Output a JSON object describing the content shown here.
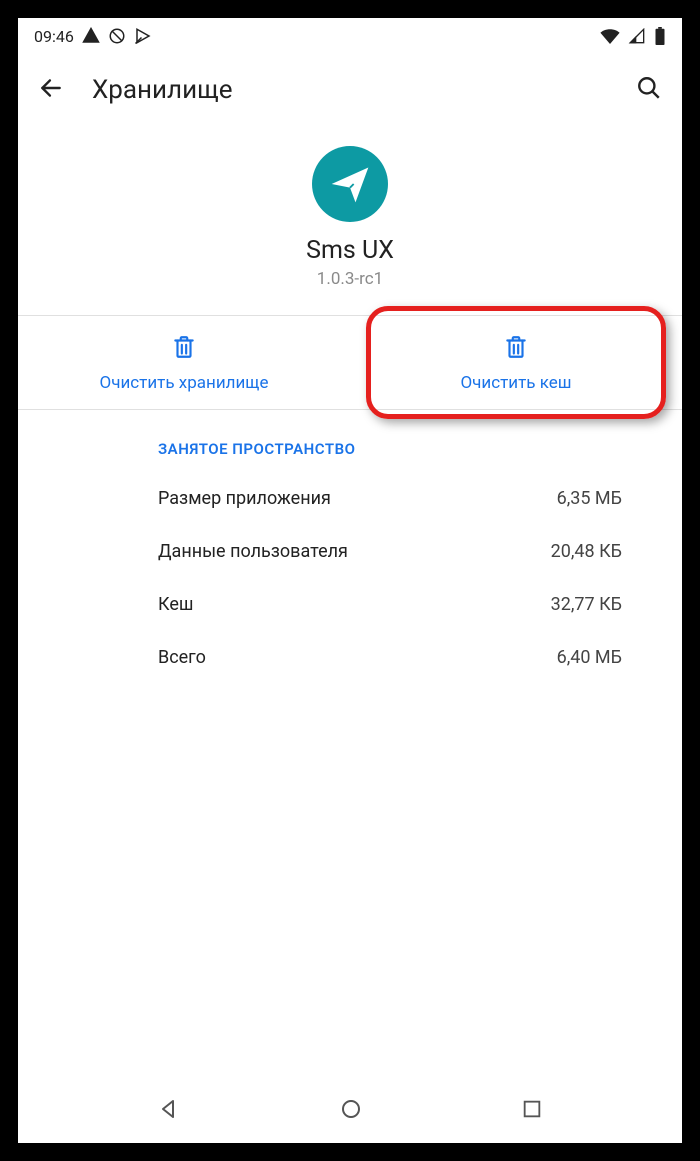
{
  "statusbar": {
    "time": "09:46"
  },
  "appbar": {
    "title": "Хранилище"
  },
  "app": {
    "name": "Sms UX",
    "version": "1.0.3-rc1"
  },
  "actions": {
    "clear_storage": "Очистить хранилище",
    "clear_cache": "Очистить кеш"
  },
  "section": {
    "header": "ЗАНЯТОЕ ПРОСТРАНСТВО"
  },
  "rows": {
    "app_size": {
      "label": "Размер приложения",
      "value": "6,35 МБ"
    },
    "user_data": {
      "label": "Данные пользователя",
      "value": "20,48 КБ"
    },
    "cache": {
      "label": "Кеш",
      "value": "32,77 КБ"
    },
    "total": {
      "label": "Всего",
      "value": "6,40 МБ"
    }
  }
}
